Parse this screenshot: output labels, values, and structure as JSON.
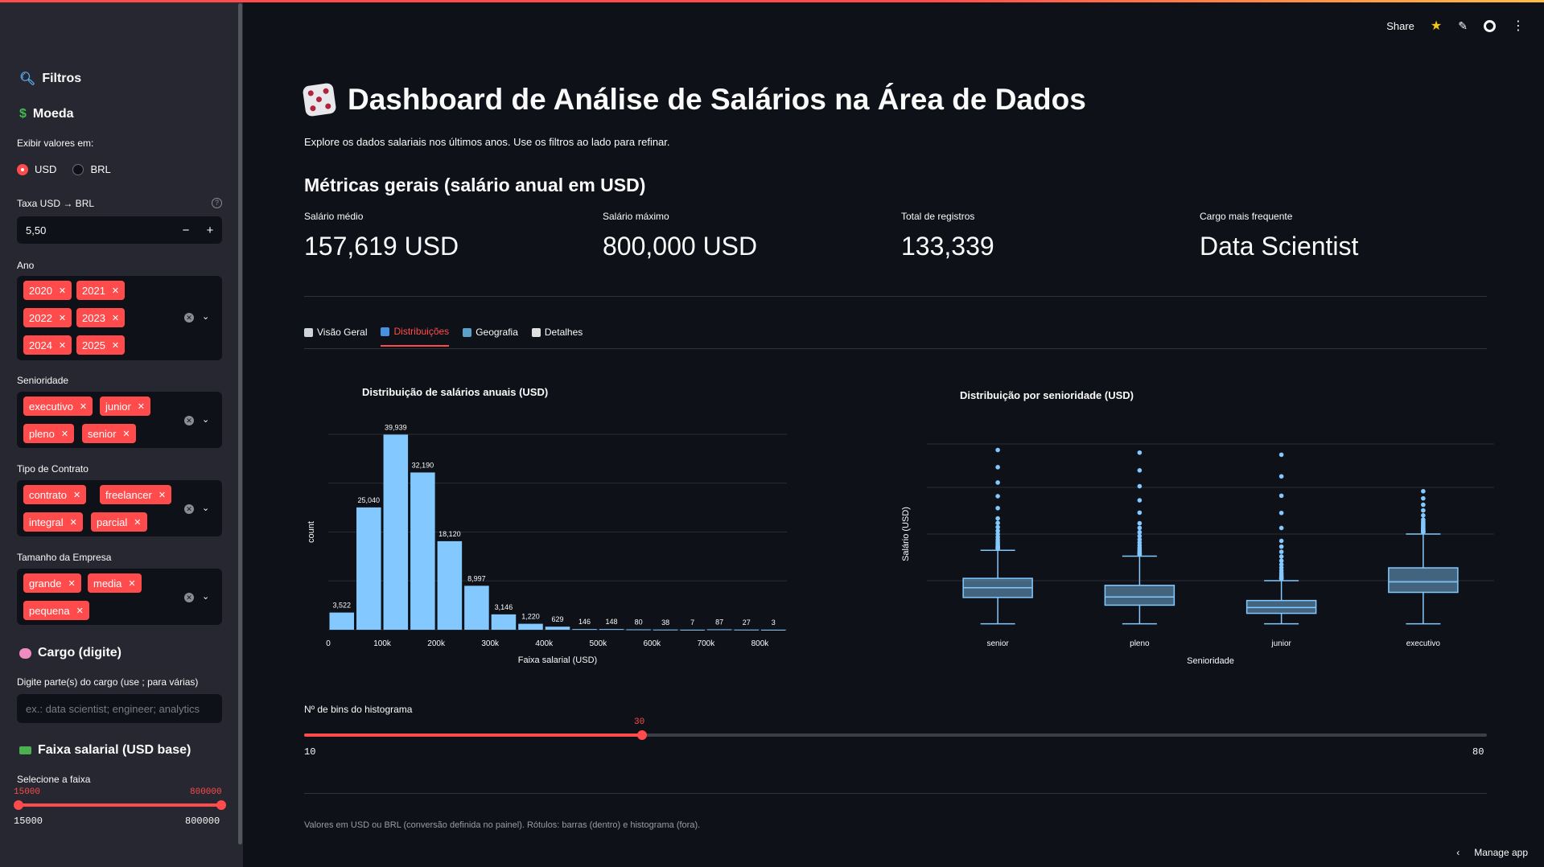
{
  "sidebar": {
    "filters_title": "Filtros",
    "currency_title": "Moeda",
    "display_label": "Exibir valores em:",
    "radio_options": [
      "USD",
      "BRL"
    ],
    "radio_selected": "USD",
    "rate_label": "Taxa USD → BRL",
    "rate_value": "5,50",
    "year_label": "Ano",
    "years": [
      "2020",
      "2021",
      "2022",
      "2023",
      "2024",
      "2025"
    ],
    "seniority_label": "Senioridade",
    "seniorities": [
      "executivo",
      "junior",
      "pleno",
      "senior"
    ],
    "contract_label": "Tipo de Contrato",
    "contracts": [
      "contrato",
      "freelancer",
      "integral",
      "parcial"
    ],
    "company_label": "Tamanho da Empresa",
    "companies": [
      "grande",
      "media",
      "pequena"
    ],
    "cargo_title": "Cargo (digite)",
    "cargo_label": "Digite parte(s) do cargo (use ; para várias)",
    "cargo_placeholder": "ex.: data scientist; engineer; analytics",
    "salary_title": "Faixa salarial (USD base)",
    "salary_label": "Selecione a faixa",
    "salary_min": "15000",
    "salary_max": "800000"
  },
  "toolbar": {
    "share": "Share"
  },
  "header": {
    "title": "Dashboard de Análise de Salários na Área de Dados",
    "subtitle": "Explore os dados salariais nos últimos anos. Use os filtros ao lado para refinar."
  },
  "metrics": {
    "heading": "Métricas gerais (salário anual em USD)",
    "items": [
      {
        "label": "Salário médio",
        "value": "157,619 USD"
      },
      {
        "label": "Salário máximo",
        "value": "800,000 USD"
      },
      {
        "label": "Total de registros",
        "value": "133,339"
      },
      {
        "label": "Cargo mais frequente",
        "value": "Data Scientist"
      }
    ]
  },
  "tabs": [
    {
      "label": "Visão Geral",
      "active": false,
      "color": "#cfd3da"
    },
    {
      "label": "Distribuições",
      "active": true,
      "color": "#4a90e2"
    },
    {
      "label": "Geografia",
      "active": false,
      "color": "#5aa0c8"
    },
    {
      "label": "Detalhes",
      "active": false,
      "color": "#e0e0e0"
    }
  ],
  "chart_data": [
    {
      "type": "bar",
      "title": "Distribuição de salários anuais (USD)",
      "xlabel": "Faixa salarial (USD)",
      "ylabel": "count",
      "x_ticks": [
        "0",
        "100k",
        "200k",
        "300k",
        "400k",
        "500k",
        "600k",
        "700k",
        "800k"
      ],
      "x_range": [
        0,
        850000
      ],
      "bin_width": 50000,
      "bin_start": 0,
      "values": [
        3522,
        25040,
        39939,
        32190,
        18120,
        8997,
        3146,
        1220,
        629,
        146,
        148,
        80,
        38,
        7,
        87,
        27,
        3
      ],
      "labels": [
        "3,522",
        "25,040",
        "39,939",
        "32,190",
        "18,120",
        "8,997",
        "3,146",
        "1,220",
        "629",
        "146",
        "148",
        "80",
        "38",
        "7",
        "87",
        "27",
        "3"
      ],
      "ylim": [
        0,
        40000
      ],
      "color": "#83c9ff"
    },
    {
      "type": "box",
      "title": "Distribuição por senioridade (USD)",
      "xlabel": "Senioridade",
      "ylabel": "Salário (USD)",
      "categories": [
        "senior",
        "pleno",
        "junior",
        "executivo"
      ],
      "boxes": [
        {
          "name": "senior",
          "min": 15000,
          "q1": 128000,
          "median": 170000,
          "q3": 210000,
          "max": 330000,
          "outliers_top": 800000
        },
        {
          "name": "pleno",
          "min": 15000,
          "q1": 95000,
          "median": 130000,
          "q3": 180000,
          "max": 305000,
          "outliers_top": 790000
        },
        {
          "name": "junior",
          "min": 15000,
          "q1": 60000,
          "median": 85000,
          "q3": 115000,
          "max": 200000,
          "outliers_top": 790000
        },
        {
          "name": "executivo",
          "min": 15000,
          "q1": 150000,
          "median": 195000,
          "q3": 255000,
          "max": 400000,
          "outliers_top": 600000
        }
      ],
      "ylim": [
        0,
        800000
      ],
      "color": "#83c9ff"
    }
  ],
  "bins_slider": {
    "label": "Nº de bins do histograma",
    "min": "10",
    "max": "80",
    "value": "30",
    "fraction": 0.2857
  },
  "footer": "Valores em USD ou BRL (conversão definida no painel). Rótulos: barras (dentro) e histograma (fora).",
  "manage_app": "Manage app"
}
